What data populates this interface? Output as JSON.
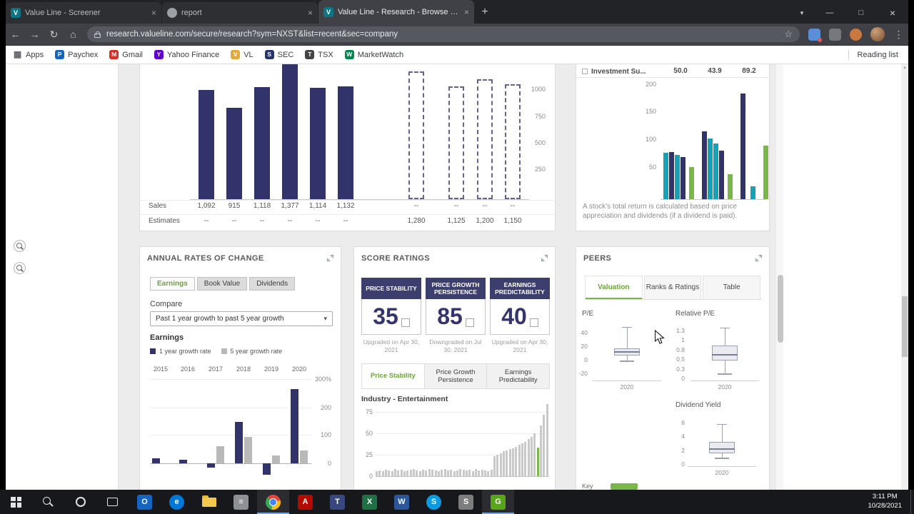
{
  "colors": {
    "navy": "#31336a",
    "teal": "#15a2b8",
    "green": "#7ab648",
    "accent_green": "#6da33c"
  },
  "glyphs": {
    "close": "×",
    "newtab": "+",
    "caret": "▾",
    "minimize": "—",
    "maximize": "□",
    "close_window": "×",
    "back": "←",
    "forward": "→",
    "reload": "↻",
    "home": "⌂",
    "star": "☆",
    "kebab": "⋮",
    "select_caret": "▾",
    "scroll_up": "▲"
  },
  "browser": {
    "tabs": [
      {
        "title": "Value Line - Screener",
        "favicon": "vl",
        "active": false
      },
      {
        "title": "report",
        "favicon": "doc",
        "active": false
      },
      {
        "title": "Value Line - Research - Browse R...",
        "favicon": "vl",
        "active": true
      }
    ],
    "url": "research.valueline.com/secure/research?sym=NXST&list=recent&sec=company",
    "bookmarks": [
      {
        "label": "Apps",
        "glyph": "▦",
        "color": "none"
      },
      {
        "label": "Paychex",
        "glyph": "P",
        "color": "#1565c0"
      },
      {
        "label": "Gmail",
        "glyph": "M",
        "color": "#d93025"
      },
      {
        "label": "Yahoo Finance",
        "glyph": "Y",
        "color": "#5f01d1"
      },
      {
        "label": "VL",
        "glyph": "V",
        "color": "#e2a93b"
      },
      {
        "label": "SEC",
        "glyph": "S",
        "color": "#27356b"
      },
      {
        "label": "TSX",
        "glyph": "T",
        "color": "#444444"
      },
      {
        "label": "MarketWatch",
        "glyph": "W",
        "color": "#00894e"
      }
    ],
    "reading_list": "Reading list"
  },
  "sales_panel": {
    "y_ticks": [
      "1000",
      "750",
      "500",
      "250"
    ],
    "row_labels": {
      "sales": "Sales",
      "estimates": "Estimates"
    },
    "columns": [
      {
        "sales": "1,092",
        "est": "--",
        "value": 1092,
        "type": "actual"
      },
      {
        "sales": "915",
        "est": "--",
        "value": 915,
        "type": "actual"
      },
      {
        "sales": "1,118",
        "est": "--",
        "value": 1118,
        "type": "actual"
      },
      {
        "sales": "1,377",
        "est": "--",
        "value": 1377,
        "type": "actual"
      },
      {
        "sales": "1,114",
        "est": "--",
        "value": 1114,
        "type": "actual"
      },
      {
        "sales": "1,132",
        "est": "--",
        "value": 1132,
        "type": "actual"
      },
      {
        "sales": "--",
        "est": "1,280",
        "value": 1280,
        "type": "estimate"
      },
      {
        "sales": "--",
        "est": "1,125",
        "value": 1125,
        "type": "estimate"
      },
      {
        "sales": "--",
        "est": "1,200",
        "value": 1200,
        "type": "estimate"
      },
      {
        "sales": "--",
        "est": "1,150",
        "value": 1150,
        "type": "estimate"
      }
    ]
  },
  "invest_panel": {
    "header": "Investment Su...",
    "header_values": [
      "50.0",
      "43.9",
      "89.2"
    ],
    "y_ticks": [
      "200",
      "150",
      "100",
      "50"
    ],
    "bars": [
      {
        "c": "teal",
        "v": 83
      },
      {
        "c": "navy",
        "v": 85
      },
      {
        "c": "teal",
        "v": 80
      },
      {
        "c": "navy",
        "v": 75
      },
      {
        "c": "green",
        "v": 58,
        "g": 4
      },
      {
        "c": "navy",
        "v": 122,
        "g": 10
      },
      {
        "c": "teal",
        "v": 109
      },
      {
        "c": "teal",
        "v": 100
      },
      {
        "c": "navy",
        "v": 87
      },
      {
        "c": "green",
        "v": 45,
        "g": 4
      },
      {
        "c": "navy",
        "v": 190,
        "g": 10
      },
      {
        "c": "teal",
        "v": 23,
        "g": 6
      },
      {
        "c": "green",
        "v": 96,
        "g": 10
      }
    ],
    "note": "A stock's total return is calculated based on price appreciation and dividends (if a dividend is paid)."
  },
  "annual_panel": {
    "title": "ANNUAL RATES OF CHANGE",
    "buttons": [
      "Earnings",
      "Book Value",
      "Dividends"
    ],
    "active_button": "Earnings",
    "compare_label": "Compare",
    "compare_value": "Past 1 year growth to past 5 year growth",
    "section_label": "Earnings",
    "legend": [
      {
        "label": "1 year growth rate",
        "color": "navy"
      },
      {
        "label": "5 year growth rate",
        "color": "gray"
      }
    ],
    "chart": {
      "type": "bar",
      "years": [
        "2015",
        "2016",
        "2017",
        "2018",
        "2019",
        "2020"
      ],
      "y_ticks": [
        "300%",
        "200",
        "100",
        "0"
      ],
      "one_year": [
        18,
        14,
        -15,
        150,
        -42,
        268
      ],
      "five_year": [
        null,
        null,
        62,
        95,
        28,
        47
      ]
    }
  },
  "score_panel": {
    "title": "SCORE RATINGS",
    "cards": [
      {
        "header": "PRICE STABILITY",
        "score": "35",
        "status": "Upgraded on Apr 30, 2021"
      },
      {
        "header": "PRICE GROWTH PERSISTENCE",
        "score": "85",
        "status": "Downgraded on Jul 30, 2021"
      },
      {
        "header": "EARNINGS PREDICTABILITY",
        "score": "40",
        "status": "Upgraded on Apr 30, 2021"
      }
    ],
    "tabs": [
      "Price Stability",
      "Price Growth Persistence",
      "Earnings Predictability"
    ],
    "active_tab": "Price Stability",
    "industry_label": "Industry - Entertainment",
    "histogram": {
      "type": "bar",
      "y_ticks": [
        "75",
        "50",
        "25",
        "0"
      ],
      "bars": [
        6,
        7,
        6,
        8,
        7,
        6,
        9,
        7,
        8,
        6,
        7,
        8,
        9,
        7,
        6,
        8,
        7,
        9,
        8,
        7,
        6,
        8,
        9,
        7,
        8,
        6,
        7,
        9,
        8,
        7,
        8,
        6,
        9,
        7,
        8,
        7,
        6,
        8,
        24,
        26,
        28,
        30,
        31,
        33,
        34,
        36,
        38,
        40,
        42,
        45,
        48,
        52,
        35,
        62,
        75,
        88
      ],
      "highlight_index": 52,
      "highlight_value": 35
    }
  },
  "peers_panel": {
    "title": "PEERS",
    "tabs": [
      "Valuation",
      "Ranks & Ratings",
      "Table"
    ],
    "active_tab": "Valuation",
    "plots": [
      {
        "label": "P/E",
        "x_label": "2020",
        "y_ticks": [
          {
            "t": "40",
            "v": 40
          },
          {
            "t": "20",
            "v": 20
          },
          {
            "t": "0",
            "v": 0
          },
          {
            "t": "-20",
            "v": -20
          }
        ],
        "box": {
          "max": 48,
          "q3": 16,
          "med": 11,
          "q1": 5,
          "min": -2
        }
      },
      {
        "label": "Relative P/E",
        "x_label": "2020",
        "y_ticks": [
          {
            "t": "1.3",
            "v": 1.25
          },
          {
            "t": "1",
            "v": 1.0
          },
          {
            "t": "0.8",
            "v": 0.75
          },
          {
            "t": "0.5",
            "v": 0.5
          },
          {
            "t": "0.3",
            "v": 0.25
          },
          {
            "t": "0",
            "v": 0
          }
        ],
        "box": {
          "max": 1.3,
          "q3": 0.85,
          "med": 0.62,
          "q1": 0.45,
          "min": 0.12
        }
      },
      {
        "label": "Dividend Yield",
        "x_label": "2020",
        "y_ticks": [
          {
            "t": "6",
            "v": 6
          },
          {
            "t": "4",
            "v": 4
          },
          {
            "t": "2",
            "v": 2
          },
          {
            "t": "0",
            "v": 0
          }
        ],
        "box": {
          "max": 5.7,
          "q3": 3.1,
          "med": 2.2,
          "q1": 1.5,
          "min": 0.8
        }
      }
    ],
    "key_label": "Key"
  },
  "taskbar": {
    "items": [
      {
        "name": "start",
        "type": "win"
      },
      {
        "name": "search",
        "type": "mag"
      },
      {
        "name": "cortana",
        "type": "ring"
      },
      {
        "name": "task-view",
        "type": "rect"
      },
      {
        "name": "outlook",
        "type": "sq",
        "color": "#1565c0",
        "glyph": "O"
      },
      {
        "name": "edge",
        "type": "circle",
        "color": "#0078d7",
        "glyph": "e"
      },
      {
        "name": "file-explorer",
        "type": "folder"
      },
      {
        "name": "settings",
        "type": "sq",
        "color": "#8d9094",
        "glyph": "≡"
      },
      {
        "name": "chrome",
        "type": "chrome",
        "active": true
      },
      {
        "name": "acrobat",
        "type": "sq",
        "color": "#b30b00",
        "glyph": "A"
      },
      {
        "name": "teams",
        "type": "sq",
        "color": "#39477f",
        "glyph": "T"
      },
      {
        "name": "excel",
        "type": "sq",
        "color": "#1f7145",
        "glyph": "X"
      },
      {
        "name": "word",
        "type": "sq",
        "color": "#2b579a",
        "glyph": "W"
      },
      {
        "name": "skype",
        "type": "circle",
        "color": "#0a9be3",
        "glyph": "S"
      },
      {
        "name": "snip",
        "type": "sq",
        "color": "#7d7d7d",
        "glyph": "S"
      },
      {
        "name": "greenshot",
        "type": "sq",
        "color": "#58a618",
        "glyph": "G",
        "active": true
      }
    ],
    "clock_time": "3:11 PM",
    "clock_date": "10/28/2021"
  }
}
